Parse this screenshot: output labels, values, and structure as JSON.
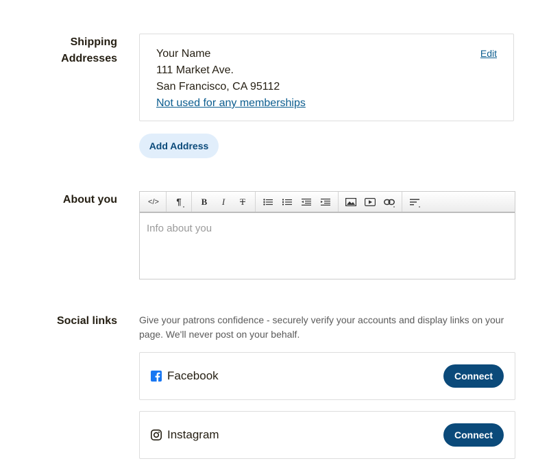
{
  "shipping": {
    "label": "Shipping Addresses",
    "label_line1": "Shipping",
    "label_line2": "Addresses",
    "address": {
      "name": "Your Name",
      "street": "111 Market Ave.",
      "city_line": "San Francisco, CA 95112",
      "membership_link": "Not used for any memberships"
    },
    "edit_label": "Edit",
    "add_button": "Add Address"
  },
  "about": {
    "label": "About you",
    "placeholder": "Info about you",
    "toolbar": [
      "code-view-icon",
      "paragraph-icon",
      "bold-icon",
      "italic-icon",
      "strikethrough-icon",
      "bulleted-list-icon",
      "numbered-list-icon",
      "outdent-icon",
      "indent-icon",
      "image-icon",
      "video-icon",
      "link-icon",
      "align-icon"
    ],
    "toolbar_glyphs": {
      "code": "</>",
      "paragraph": "¶",
      "bold": "B",
      "italic": "I",
      "strike": "T"
    }
  },
  "social": {
    "label": "Social links",
    "description": "Give your patrons confidence - securely verify your accounts and display links on your page. We'll never post on your behalf.",
    "items": [
      {
        "name": "Facebook",
        "icon": "facebook-icon",
        "button": "Connect"
      },
      {
        "name": "Instagram",
        "icon": "instagram-icon",
        "button": "Connect"
      }
    ]
  },
  "colors": {
    "accent": "#0b4a7a",
    "link": "#0c5d8f",
    "add_button_bg": "#e1eefb",
    "facebook": "#1877f2"
  }
}
